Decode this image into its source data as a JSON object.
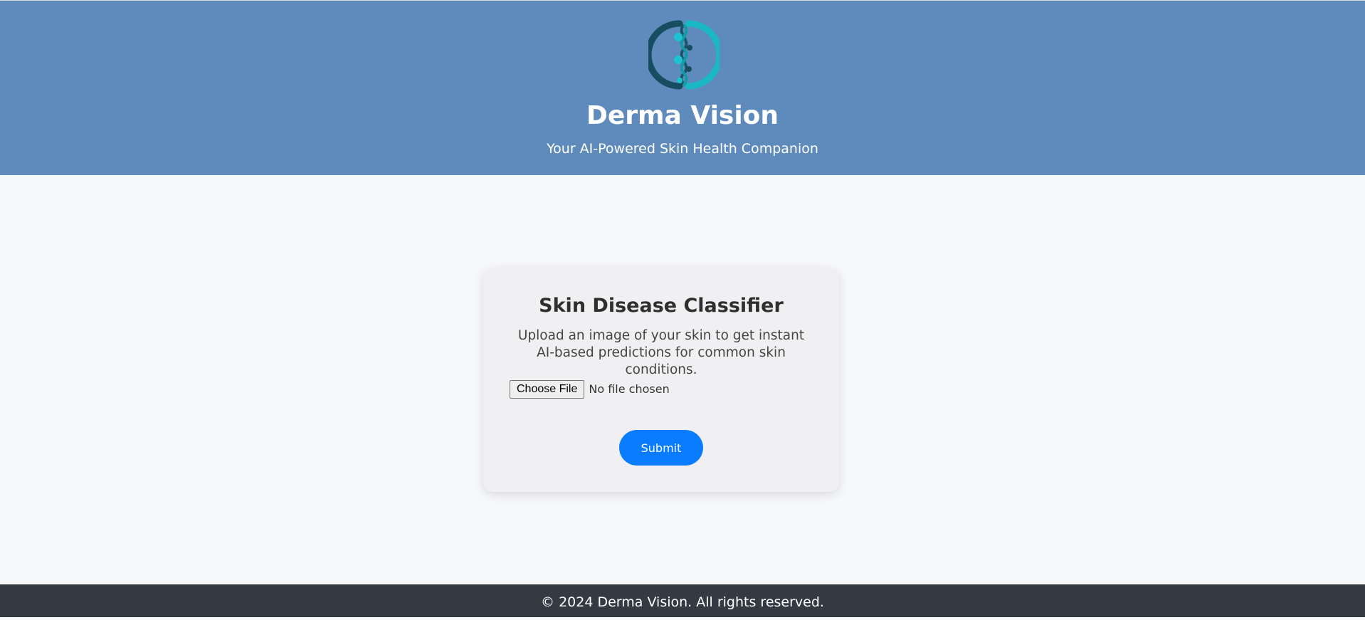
{
  "header": {
    "logo_icon": "dna-helix-circle-logo",
    "title": "Derma Vision",
    "tagline": "Your AI-Powered Skin Health Companion",
    "background_color": "#5e8bbb"
  },
  "classifier": {
    "title": "Skin Disease Classifier",
    "description": "Upload an image of your skin to get instant AI-based predictions for common skin conditions.",
    "file_input": {
      "button_label": "Choose File",
      "status": "No file chosen"
    },
    "submit_label": "Submit",
    "submit_color": "#0a7cff"
  },
  "footer": {
    "text": "© 2024 Derma Vision. All rights reserved.",
    "background_color": "#343a42"
  }
}
